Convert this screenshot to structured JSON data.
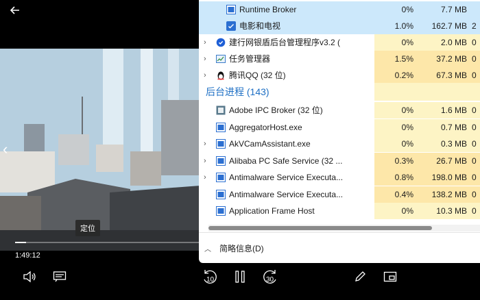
{
  "player": {
    "back_icon": "arrow-left-icon",
    "tooltip": "定位",
    "time": "1:49:12",
    "progress_fraction": 0.06,
    "controls": {
      "volume_icon": "speaker-icon",
      "subtitles_icon": "subtitles-icon",
      "skip_back": "10",
      "pause_icon": "pause-icon",
      "skip_forward": "30",
      "edit_icon": "pencil-icon",
      "miniview_icon": "mini-view-icon"
    }
  },
  "task_manager": {
    "rows_top": [
      {
        "name": "Runtime Broker",
        "cpu": "0%",
        "mem": "7.7 MB",
        "extra": "",
        "indent": true,
        "icon": "app-frame-icon",
        "selected": true
      },
      {
        "name": "电影和电视",
        "cpu": "1.0%",
        "mem": "162.7 MB",
        "extra": "2",
        "indent": true,
        "icon": "movies-tv-icon",
        "selected": true
      },
      {
        "name": "建行网银盾后台管理程序v3.2 (",
        "cpu": "0%",
        "mem": "2.0 MB",
        "extra": "0",
        "expandable": true,
        "icon": "ccb-shield-icon",
        "color": "#1e5fd6"
      },
      {
        "name": "任务管理器",
        "cpu": "1.5%",
        "mem": "37.2 MB",
        "extra": "0",
        "expandable": true,
        "icon": "task-manager-icon",
        "group": true
      },
      {
        "name": "腾讯QQ (32 位)",
        "cpu": "0.2%",
        "mem": "67.3 MB",
        "extra": "0",
        "expandable": true,
        "icon": "qq-penguin-icon",
        "group": true
      }
    ],
    "section_title": "后台进程 (143)",
    "rows_bg": [
      {
        "name": "Adobe IPC Broker (32 位)",
        "cpu": "0%",
        "mem": "1.6 MB",
        "extra": "0",
        "icon": "adobe-ipc-icon"
      },
      {
        "name": "AggregatorHost.exe",
        "cpu": "0%",
        "mem": "0.7 MB",
        "extra": "0",
        "icon": "app-frame-icon"
      },
      {
        "name": "AkVCamAssistant.exe",
        "cpu": "0%",
        "mem": "0.3 MB",
        "extra": "0",
        "expandable": true,
        "icon": "app-frame-icon"
      },
      {
        "name": "Alibaba PC Safe Service (32 ...",
        "cpu": "0.3%",
        "mem": "26.7 MB",
        "extra": "0",
        "expandable": true,
        "icon": "app-frame-icon",
        "group": true
      },
      {
        "name": "Antimalware Service Executa...",
        "cpu": "0.8%",
        "mem": "198.0 MB",
        "extra": "0",
        "expandable": true,
        "icon": "app-frame-icon",
        "group": true
      },
      {
        "name": "Antimalware Service Executa...",
        "cpu": "0.4%",
        "mem": "138.2 MB",
        "extra": "0",
        "icon": "app-frame-icon",
        "group": true
      },
      {
        "name": "Application Frame Host",
        "cpu": "0%",
        "mem": "10.3 MB",
        "extra": "0",
        "icon": "app-frame-icon"
      }
    ],
    "fewer_details": "简略信息(D)"
  }
}
